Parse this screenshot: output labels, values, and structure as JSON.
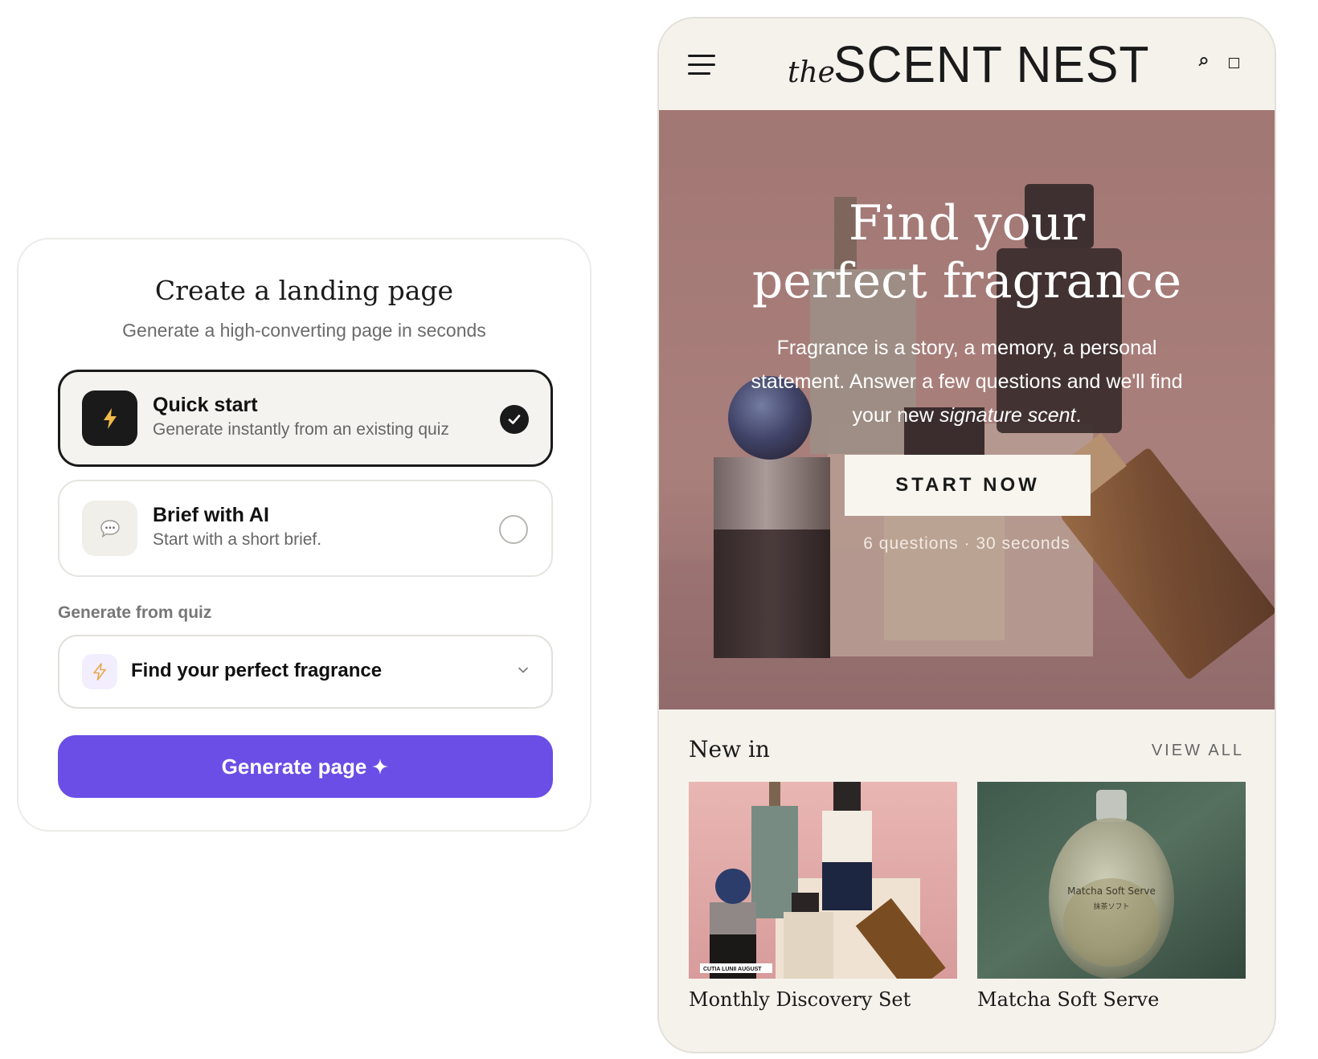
{
  "landing_card": {
    "title": "Create a landing page",
    "subtitle": "Generate a high-converting page in seconds",
    "options": [
      {
        "title": "Quick start",
        "description": "Generate instantly from an existing quiz",
        "selected": true,
        "icon": "lightning-icon"
      },
      {
        "title": "Brief with AI",
        "description": "Start with a short brief.",
        "selected": false,
        "icon": "chat-bubble-icon"
      }
    ],
    "quiz_label": "Generate from quiz",
    "quiz_select": {
      "value": "Find your perfect fragrance",
      "icon": "lightning-icon"
    },
    "generate_button": "Generate page",
    "accent_color": "#6b4ee6"
  },
  "phone": {
    "brand_the": "the",
    "brand_name": "SCENT NEST",
    "hero": {
      "title_line1": "Find your",
      "title_line2": "perfect fragrance",
      "body_1": "Fragrance is a story, a memory, a personal statement. Answer a few questions and we'll find your new ",
      "body_em": "signature scent",
      "body_2": ".",
      "cta": "START NOW",
      "meta": "6 questions · 30 seconds"
    },
    "new_in": {
      "heading": "New in",
      "view_all": "VIEW ALL",
      "products": [
        {
          "name": "Monthly Discovery Set",
          "tag": "CUTIA LUNII AUGUST"
        },
        {
          "name": "Matcha Soft Serve",
          "label_1": "Matcha Soft Serve",
          "label_2": "抹茶ソフト"
        }
      ]
    }
  }
}
